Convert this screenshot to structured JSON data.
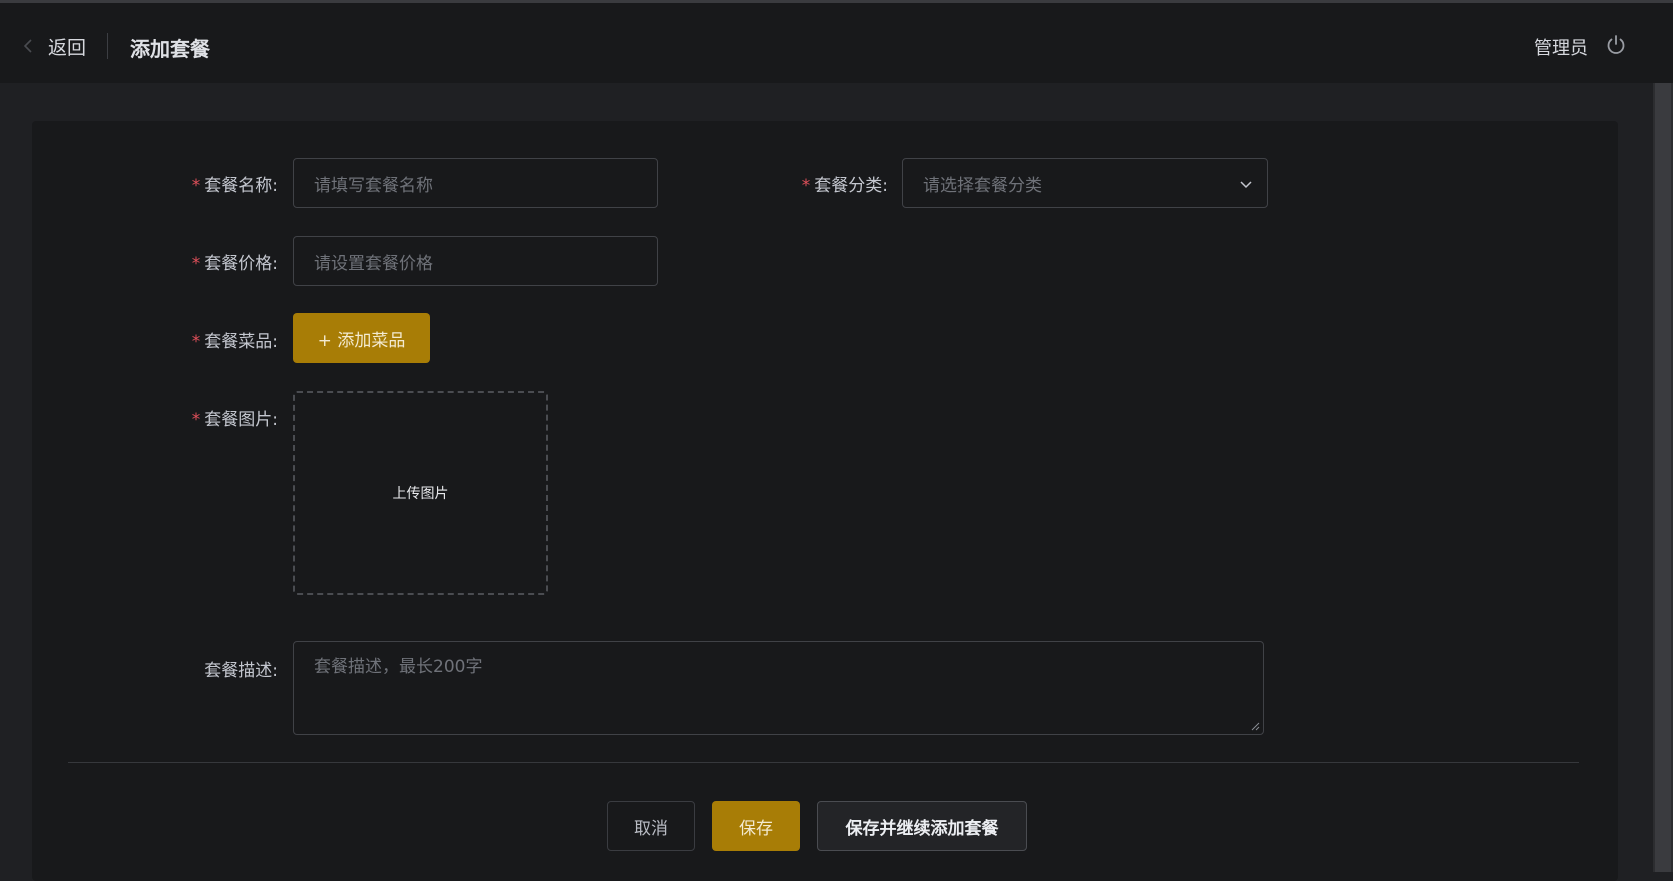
{
  "header": {
    "back_label": "返回",
    "title": "添加套餐",
    "user": "管理员"
  },
  "form": {
    "required_mark": "*",
    "name": {
      "label": "套餐名称:",
      "placeholder": "请填写套餐名称"
    },
    "category": {
      "label": "套餐分类:",
      "placeholder": "请选择套餐分类"
    },
    "price": {
      "label": "套餐价格:",
      "placeholder": "请设置套餐价格"
    },
    "dishes": {
      "label": "套餐菜品:",
      "button": "+ 添加菜品"
    },
    "image": {
      "label": "套餐图片:",
      "upload_text": "上传图片"
    },
    "description": {
      "label": "套餐描述:",
      "placeholder": "套餐描述，最长200字"
    }
  },
  "actions": {
    "cancel": "取消",
    "save": "保存",
    "save_continue": "保存并继续添加套餐"
  },
  "colors": {
    "accent": "#a87d06",
    "required": "#e0505a",
    "background": "#1f2023",
    "card": "#18191b"
  },
  "icons": [
    "back-arrow-icon",
    "power-icon",
    "chevron-down-icon",
    "resize-handle-icon"
  ]
}
